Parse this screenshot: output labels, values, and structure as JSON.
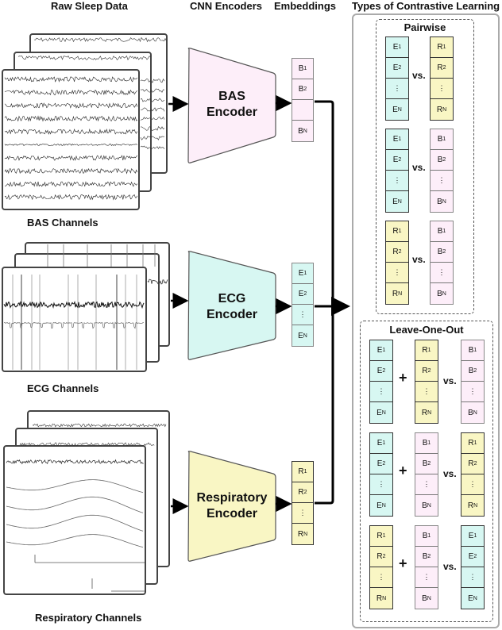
{
  "headers": {
    "raw": "Raw Sleep Data",
    "cnn": "CNN Encoders",
    "emb": "Embeddings",
    "types": "Types of Contrastive Learning"
  },
  "channels": [
    {
      "id": "bas",
      "label": "BAS Channels"
    },
    {
      "id": "ecg",
      "label": "ECG Channels"
    },
    {
      "id": "resp",
      "label": "Respiratory Channels"
    }
  ],
  "encoders": [
    {
      "id": "bas",
      "line1": "BAS",
      "line2": "Encoder",
      "color": "#fdeef9"
    },
    {
      "id": "ecg",
      "line1": "ECG",
      "line2": "Encoder",
      "color": "#d7f7f2"
    },
    {
      "id": "resp",
      "line1": "Respiratory",
      "line2": "Encoder",
      "color": "#f9f6c4"
    }
  ],
  "embeddings": {
    "bas": {
      "letter": "B",
      "cells": [
        "1",
        "2",
        "",
        "N"
      ]
    },
    "ecg": {
      "letter": "E",
      "cells": [
        "1",
        "2",
        "⋮",
        "N"
      ]
    },
    "resp": {
      "letter": "R",
      "cells": [
        "1",
        "2",
        "⋮",
        "N"
      ]
    }
  },
  "pairwise": {
    "title": "Pairwise",
    "vs": "vs.",
    "rows": [
      [
        "E",
        "R"
      ],
      [
        "E",
        "B"
      ],
      [
        "R",
        "B"
      ]
    ]
  },
  "leave_one_out": {
    "title": "Leave-One-Out",
    "plus": "+",
    "vs": "vs.",
    "rows": [
      [
        "E",
        "R",
        "B"
      ],
      [
        "E",
        "B",
        "R"
      ],
      [
        "R",
        "B",
        "E"
      ]
    ]
  },
  "colors": {
    "B": "#fdeef9",
    "E": "#d7f7f2",
    "R": "#f9f6c4"
  }
}
